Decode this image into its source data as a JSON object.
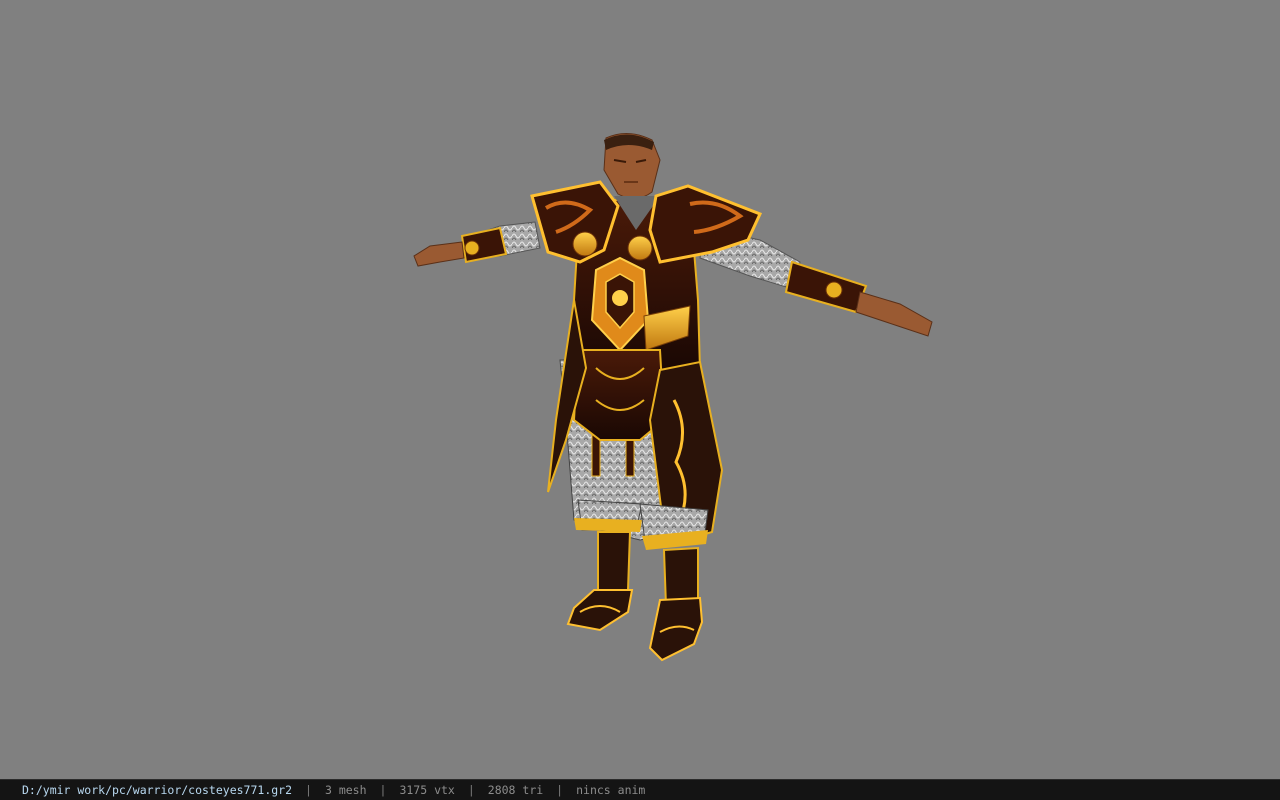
{
  "status_bar": {
    "file_path": "D:/ymir work/pc/warrior/costeyes771.gr2",
    "separator": "|",
    "mesh_count": "3 mesh",
    "vertex_count": "3175 vtx",
    "triangle_count": "2808 tri",
    "animation": "nincs anim"
  },
  "viewport": {
    "background_color": "#808080",
    "model_subject": "warrior-character-t-pose"
  },
  "colors": {
    "armor_gold": "#e8b020",
    "armor_dark": "#2a1208",
    "armor_red": "#8a2a10",
    "cloth_silver": "#b8b8b8",
    "skin": "#9a5a32",
    "path_text": "#b8d8f0",
    "status_bg": "#141414"
  }
}
